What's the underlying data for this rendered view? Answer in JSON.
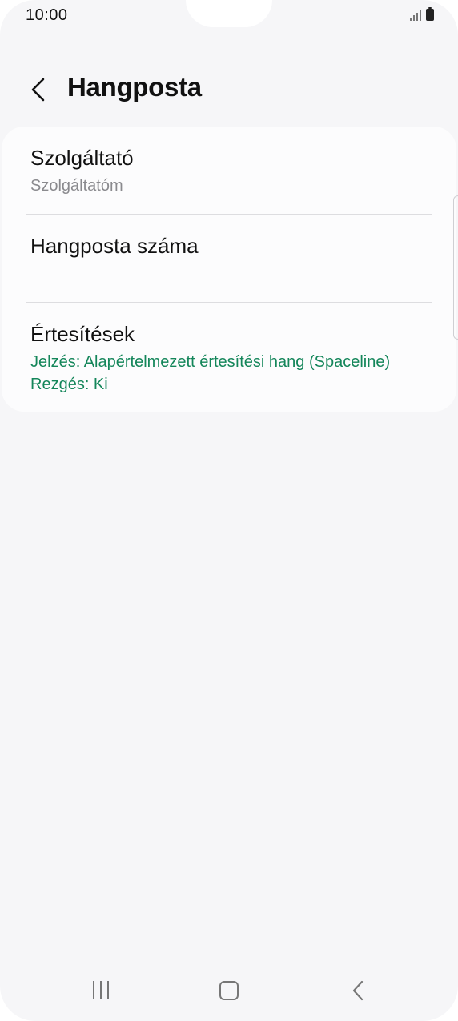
{
  "status_bar": {
    "time": "10:00",
    "icons": [
      "signal-icon",
      "battery-icon"
    ]
  },
  "header": {
    "back_icon": "chevron-left-icon",
    "title": "Hangposta"
  },
  "settings": {
    "provider": {
      "title": "Szolgáltató",
      "value": "Szolgáltatóm"
    },
    "voicemail_number": {
      "title": "Hangposta száma"
    },
    "notifications": {
      "title": "Értesítések",
      "sound": "Jelzés: Alapértelmezett értesítési hang (Spaceline)",
      "vibration": "Rezgés: Ki"
    }
  },
  "nav_bar": {
    "icons": [
      "recent-apps-icon",
      "home-icon",
      "back-icon"
    ]
  },
  "colors": {
    "background": "#f6f6f8",
    "card": "#fcfcfd",
    "accent_green": "#14865a",
    "secondary_text": "#8a8a8e"
  }
}
